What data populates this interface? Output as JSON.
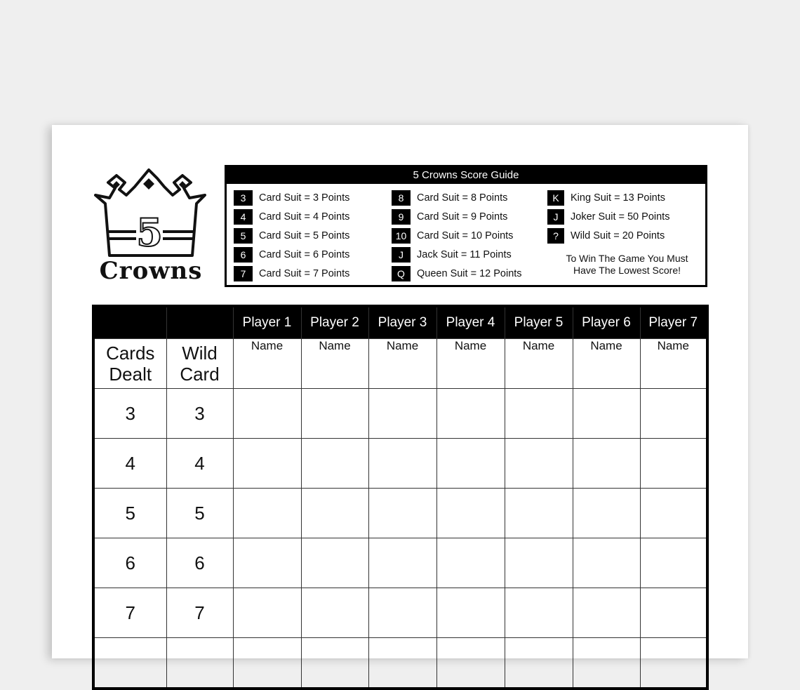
{
  "logo": {
    "number": "5",
    "word": "Crowns"
  },
  "guide": {
    "title": "5 Crowns Score Guide",
    "columns": [
      [
        {
          "badge": "3",
          "text": "Card Suit = 3 Points"
        },
        {
          "badge": "4",
          "text": "Card Suit = 4 Points"
        },
        {
          "badge": "5",
          "text": "Card Suit = 5 Points"
        },
        {
          "badge": "6",
          "text": "Card Suit = 6 Points"
        },
        {
          "badge": "7",
          "text": "Card Suit = 7 Points"
        }
      ],
      [
        {
          "badge": "8",
          "text": "Card Suit = 8 Points"
        },
        {
          "badge": "9",
          "text": "Card Suit = 9 Points"
        },
        {
          "badge": "10",
          "text": "Card Suit = 10 Points"
        },
        {
          "badge": "J",
          "text": "Jack Suit = 11 Points"
        },
        {
          "badge": "Q",
          "text": "Queen Suit = 12 Points"
        }
      ],
      [
        {
          "badge": "K",
          "text": "King Suit = 13 Points"
        },
        {
          "badge": "J",
          "text": "Joker Suit = 50 Points"
        },
        {
          "badge": "?",
          "text": "Wild Suit = 20 Points"
        }
      ]
    ],
    "note_line1": "To Win The Game You Must",
    "note_line2": "Have The Lowest Score!"
  },
  "table": {
    "players": [
      "Player 1",
      "Player 2",
      "Player 3",
      "Player 4",
      "Player 5",
      "Player 6",
      "Player 7"
    ],
    "name_label": "Name",
    "col1_line1": "Cards",
    "col1_line2": "Dealt",
    "col2_line1": "Wild",
    "col2_line2": "Card",
    "rows": [
      {
        "dealt": "3",
        "wild": "3"
      },
      {
        "dealt": "4",
        "wild": "4"
      },
      {
        "dealt": "5",
        "wild": "5"
      },
      {
        "dealt": "6",
        "wild": "6"
      },
      {
        "dealt": "7",
        "wild": "7"
      }
    ]
  }
}
